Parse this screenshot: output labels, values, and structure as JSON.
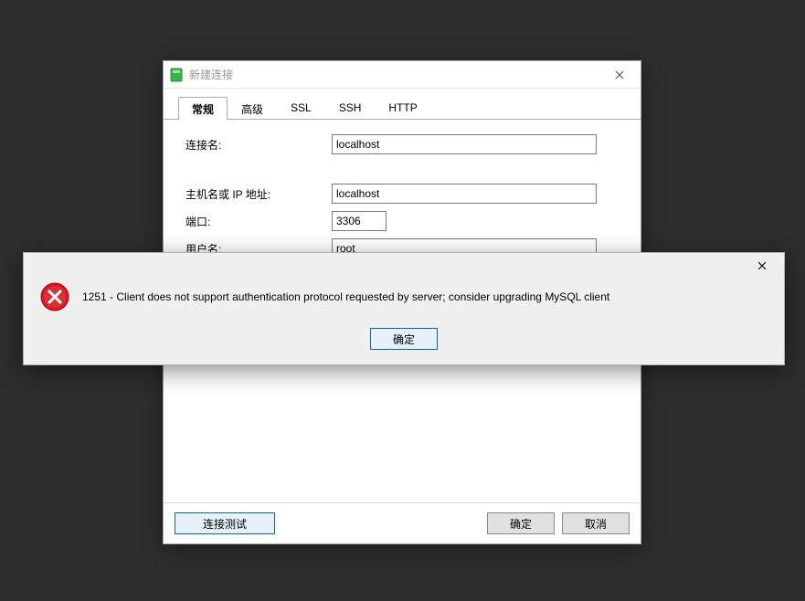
{
  "dialog": {
    "title": "新建连接",
    "tabs": [
      {
        "label": "常规"
      },
      {
        "label": "高级"
      },
      {
        "label": "SSL"
      },
      {
        "label": "SSH"
      },
      {
        "label": "HTTP"
      }
    ],
    "fields": {
      "connection_name_label": "连接名:",
      "connection_name_value": "localhost",
      "host_label": "主机名或 IP 地址:",
      "host_value": "localhost",
      "port_label": "端口:",
      "port_value": "3306",
      "user_label": "用户名:",
      "user_value": "root"
    },
    "buttons": {
      "test": "连接测试",
      "ok": "确定",
      "cancel": "取消"
    }
  },
  "error": {
    "message": "1251 - Client does not support authentication protocol requested by server; consider upgrading MySQL client",
    "ok": "确定"
  },
  "colors": {
    "app_icon": "#3db14a",
    "error_red_outer": "#d13438",
    "error_red_inner": "#e81123"
  }
}
